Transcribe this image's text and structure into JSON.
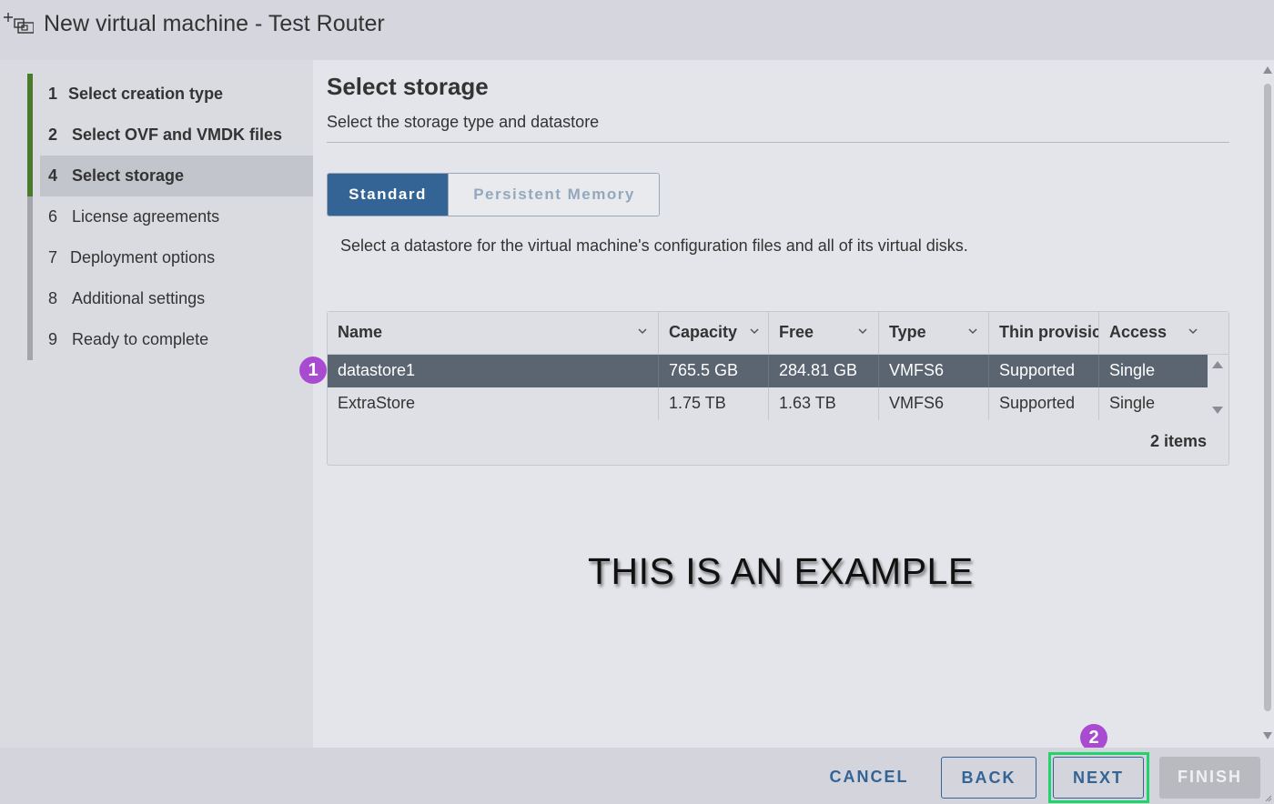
{
  "window": {
    "title": "New virtual machine - Test Router",
    "icon": "add-vm-icon"
  },
  "sidebar": {
    "steps": [
      {
        "num": "1",
        "label": "Select creation type"
      },
      {
        "num": "2",
        "label": "Select OVF and VMDK files"
      },
      {
        "num": "4",
        "label": "Select storage"
      },
      {
        "num": "6",
        "label": "License agreements"
      },
      {
        "num": "7",
        "label": "Deployment options"
      },
      {
        "num": "8",
        "label": "Additional settings"
      },
      {
        "num": "9",
        "label": "Ready to complete"
      }
    ]
  },
  "main": {
    "heading": "Select storage",
    "subheading": "Select the storage type and datastore",
    "tabs": {
      "standard": "Standard",
      "persistent": "Persistent Memory"
    },
    "description": "Select a datastore for the virtual machine's configuration files and all of its virtual disks.",
    "table": {
      "columns": [
        "Name",
        "Capacity",
        "Free",
        "Type",
        "Thin provisic",
        "Access"
      ],
      "rows": [
        [
          "datastore1",
          "765.5 GB",
          "284.81 GB",
          "VMFS6",
          "Supported",
          "Single"
        ],
        [
          "ExtraStore",
          "1.75 TB",
          "1.63 TB",
          "VMFS6",
          "Supported",
          "Single"
        ]
      ],
      "selected_row": 0,
      "footer": "2 items"
    },
    "watermark": "THIS IS AN EXAMPLE"
  },
  "annotations": {
    "badge1": "1",
    "badge2": "2",
    "badge_color": "#a84bd1",
    "highlight_color": "#21d36b"
  },
  "footer": {
    "cancel": "CANCEL",
    "back": "BACK",
    "next": "NEXT",
    "finish": "FINISH"
  },
  "colors": {
    "accent": "#336495",
    "completed_step": "#4a7a2c",
    "selected_row": "#5a6571"
  }
}
